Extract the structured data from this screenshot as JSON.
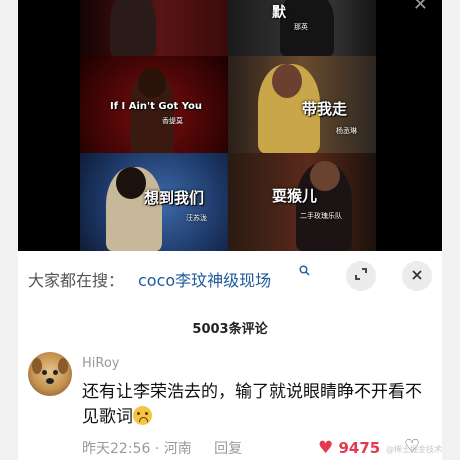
{
  "video": {
    "close_glyph": "✕",
    "cells": [
      {
        "caption": "",
        "singer": ""
      },
      {
        "caption": "默",
        "singer": "那英"
      },
      {
        "caption": "If I Ain't Got You",
        "singer": "香缇莫"
      },
      {
        "caption": "带我走",
        "singer": "杨丞琳"
      },
      {
        "caption": "想到我们",
        "singer": "汪苏泷"
      },
      {
        "caption": "耍猴儿",
        "singer": "二手玫瑰乐队"
      }
    ]
  },
  "search": {
    "prefix": "大家都在搜：",
    "query": "coco李玟神级现场",
    "search_icon": "search-icon",
    "expand_icon": "expand-icon",
    "close_icon": "close-icon"
  },
  "comments": {
    "count_label": "5003条评论",
    "items": [
      {
        "username": "HiRoy",
        "text": "还有让李荣浩去的，输了就说眼睛睁不开看不见歌词",
        "emoji": "crying-face-icon",
        "time_location": "昨天22:56 · 河南",
        "reply_label": "回复",
        "likes": "9475"
      }
    ]
  },
  "watermark": "@稀土掘金技术社区",
  "colors": {
    "accent_blue": "#1f5a9c",
    "like_red": "#e33a50"
  }
}
